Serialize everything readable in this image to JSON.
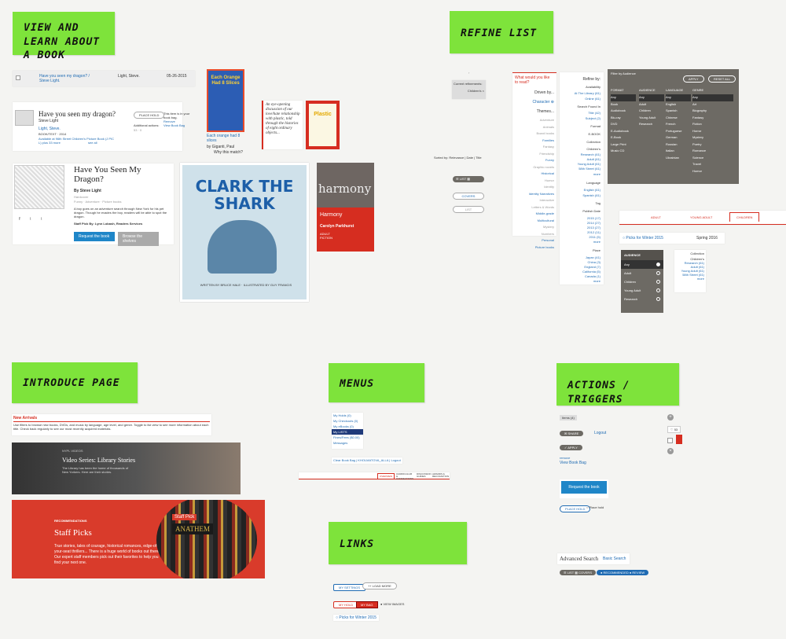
{
  "stickies": {
    "view_learn": "View and Learn About a Book",
    "refine": "Refine List",
    "introduce": "Introduce Page",
    "menus": "Menus",
    "actions": "Actions / Triggers",
    "links": "Links"
  },
  "list_row": {
    "title": "Have you seen my dragon? / Steve Light.",
    "author": "Light, Steve.",
    "date": "05-26-2015"
  },
  "brief": {
    "title": "Have you seen my dragon?",
    "author": "Steve Light",
    "author_link": "Light, Steve.",
    "format": "BOOK/TEXT  ·  2014",
    "availability": "Available at 96th Street Children's Picture Book (J PIC L) plus 33 more",
    "see_all": "see all",
    "place_hold": "PLACE HOLD",
    "additional": "Additional actions:",
    "counts": "53  ·  0",
    "bag_note": "This item is in your book bag.",
    "remove": "Remove",
    "view_bag": "View Book Bag"
  },
  "full": {
    "title": "Have You Seen My Dragon?",
    "author": "By Steve Light",
    "subtitle": "Hardcover",
    "tags": "Funny · Adventure · Picture books",
    "desc": "A boy goes on an adventure search through New York for his pet dragon. Though he evades the boy, readers will be able to spot the dragon.",
    "staff_pick": "Staff Pick By: Lynn Lobash, Readers Services",
    "request": "Request the book",
    "browse": "Browse the shelves",
    "social": [
      "f",
      "t",
      "t"
    ]
  },
  "covers": {
    "oranges_title": "Each Orange Had 8 Slices",
    "oranges_caption": "Each orange had 8 slices",
    "oranges_author": "by Giganti, Paul",
    "why_match": "Why this match?",
    "plastic_blurb": "An eye-opening discussion of our love/hate relationship with plastic, told through the histories of eight ordinary objects...",
    "plastic_title": "Plastic",
    "clark": "CLARK THE SHARK",
    "clark_credits": "WRITTEN BY BRUCE HALE · ILLUSTRATED BY GUY FRANCIS",
    "harmony_title": "harmony",
    "harmony_label": "Harmony",
    "harmony_author": "Carolyn Parkhurst",
    "harmony_tag": "ADULT FICTION"
  },
  "refine_small": {
    "refinements": "Current refinements:",
    "chip": "Children's",
    "sorted": "Sorted by: Relevance | Date | Title",
    "list_label": "LIST",
    "covers_label": "COVERS",
    "list_btn": "LIST"
  },
  "what_read": {
    "question": "What would you like to read?",
    "driven": "Driven by...",
    "character": "Character",
    "themes": "Themes...",
    "items": [
      "Adventure",
      "Animals",
      "Board books",
      "Families",
      "Fantasy",
      "Friendship",
      "Funny",
      "Graphic novels",
      "Historical",
      "Humor",
      "Identity",
      "Identity Narratives",
      "Interactive",
      "Letters & Words",
      "Middle-grade",
      "Multicultural",
      "Mystery",
      "Numbers",
      "Personal",
      "Picture books"
    ]
  },
  "refine_by": {
    "heading": "Refine by:",
    "availability": "Availability",
    "avail_items": [
      "At The Library (61)",
      "Online (61)"
    ],
    "search_found": "Search Found In",
    "found_items": [
      "Title (42)",
      "Subject (2)"
    ],
    "format": "Format",
    "ebook": "E-BOOK",
    "collection": "Collection",
    "coll_items": [
      "Children's",
      "Research (61)",
      "Adult (61)",
      "Young Adult (61)",
      "58th Street (61)",
      "more"
    ],
    "language": "Language",
    "lang_items": [
      "English (61)",
      "Spanish (61)"
    ],
    "tag": "Tag",
    "publish": "Publish Date",
    "pub_items": [
      "2015 (17)",
      "2014 (27)",
      "2013 (27)",
      "2012 (11)",
      "2011 (5)",
      "more"
    ],
    "place": "Place",
    "place_items": [
      "Japan (41)",
      "China (3)",
      "England (7)",
      "California (5)",
      "Canada (1)",
      "more"
    ]
  },
  "dark_panel": {
    "title": "Filter by Audience",
    "tabs": [
      "APPLY",
      "RESET ALL"
    ],
    "columns": [
      "FORMAT",
      "AUDIENCE",
      "LANGUAGE",
      "GENRE"
    ],
    "format_items": [
      "Any",
      "Book",
      "Audiobook",
      "Blu-ray",
      "DVD",
      "E-Audiobook",
      "E-Book",
      "Large Print",
      "Music CD"
    ],
    "audience_items": [
      "Any",
      "Adult",
      "Children",
      "Young Adult",
      "Research"
    ],
    "language_items": [
      "Any",
      "English",
      "Spanish",
      "Chinese",
      "French",
      "Portuguese",
      "German",
      "Russian",
      "Italian",
      "Ukrainian"
    ],
    "genre_items": [
      "Any",
      "Art",
      "Biography",
      "Fantasy",
      "Fiction",
      "Horror",
      "Mystery",
      "Poetry",
      "Romance",
      "Science",
      "Travel",
      "Humor"
    ]
  },
  "tabs_row": [
    "ADULT",
    "YOUNG ADULT",
    "CHILDREN"
  ],
  "picks_link": "Picks for Winter 2015",
  "season": "Spring 2016",
  "audience_box": {
    "heading": "AUDIENCE",
    "items": [
      "Any",
      "Adult",
      "Children",
      "Young Adult",
      "Research"
    ]
  },
  "collection_box": {
    "heading": "Collection",
    "items": [
      "Children's",
      "Research (61)",
      "Adult (61)",
      "Young Adult (61)",
      "58th Street (61)",
      "more"
    ]
  },
  "intro": {
    "new_arrivals": "New Arrivals",
    "new_desc": "Use filters to browse new books, DVDs, and music by language, age level, and genre. Toggle to list view to see more information about each title. Check back regularly to see our most recently acquired materials.",
    "video_kicker": "NYPL VIDEOS",
    "video_title": "Video Series: Library Stories",
    "video_desc": "The Library has been the home of thousands of New Yorkers. Here are their stories.",
    "rec_kicker": "RECOMMENDATIONS",
    "rec_title": "Staff Picks",
    "rec_desc": "True stories, tales of courage, historical romances, edge-of-your-seat thrillers... There is a huge world of books out there. Our expert staff members pick out their favorites to help you find your next one.",
    "badge": "Staff Pick",
    "book": "ANATHEM"
  },
  "menus": {
    "items": [
      "My Holds (0)",
      "My Checkouts (0)",
      "My eBooks (0)",
      "My LISTS",
      "Fines/Fees ($0.00)",
      "Messages"
    ],
    "bar": "Clear Book Bag  |  KHOLMATOVA_ALLA  |  Logout",
    "tabs": [
      "OVERVIEW",
      "CURRICULUM & CONNECTIONS",
      "DISCUSSION GUIDES",
      "AWARDS & RECOGNITION"
    ]
  },
  "links": {
    "my_settings": "MY SETTINGS",
    "load_more": "LOAD MORE",
    "red1": "MY HOLD",
    "red2": "MY BAG",
    "view_images": "VIEW IMAGES",
    "picks": "Picks for Winter 2015"
  },
  "actions": {
    "items_tag": "Items (4)",
    "logout": "Logout",
    "share": "SHARE",
    "apply": "APPLY",
    "remove": "remove",
    "view_bag": "View Book Bag",
    "request": "Request the book",
    "place_hold_btn": "PLACE HOLD",
    "place_hold": "Place hold",
    "counter": "53",
    "adv": "Advanced Search",
    "basic": "Basic Search",
    "list": "LIST",
    "covers": "COVERS",
    "recommend": "RECOMMENDED",
    "review": "REVIEW"
  }
}
